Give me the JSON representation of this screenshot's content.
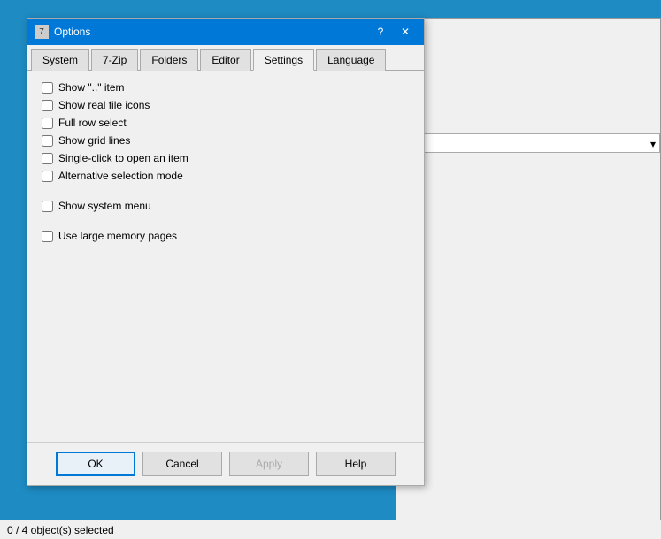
{
  "titlebar": {
    "icon_label": "7",
    "title": "Options",
    "help_btn": "?",
    "close_btn": "✕"
  },
  "tabs": [
    {
      "label": "System",
      "active": false
    },
    {
      "label": "7-Zip",
      "active": false
    },
    {
      "label": "Folders",
      "active": false
    },
    {
      "label": "Editor",
      "active": false
    },
    {
      "label": "Settings",
      "active": true
    },
    {
      "label": "Language",
      "active": false
    }
  ],
  "checkboxes": [
    {
      "id": "cb1",
      "label": "Show \"..\" item",
      "checked": false
    },
    {
      "id": "cb2",
      "label": "Show real file icons",
      "checked": false
    },
    {
      "id": "cb3",
      "label": "Full row select",
      "checked": false
    },
    {
      "id": "cb4",
      "label": "Show grid lines",
      "checked": false
    },
    {
      "id": "cb5",
      "label": "Single-click to open an item",
      "checked": false
    },
    {
      "id": "cb6",
      "label": "Alternative selection mode",
      "checked": false
    },
    {
      "id": "cb7",
      "label": "Show system menu",
      "checked": false
    },
    {
      "id": "cb8",
      "label": "Use large memory pages",
      "checked": false
    }
  ],
  "buttons": {
    "ok": "OK",
    "cancel": "Cancel",
    "apply": "Apply",
    "help": "Help"
  },
  "statusbar": {
    "text": "0 / 4 object(s) selected"
  }
}
